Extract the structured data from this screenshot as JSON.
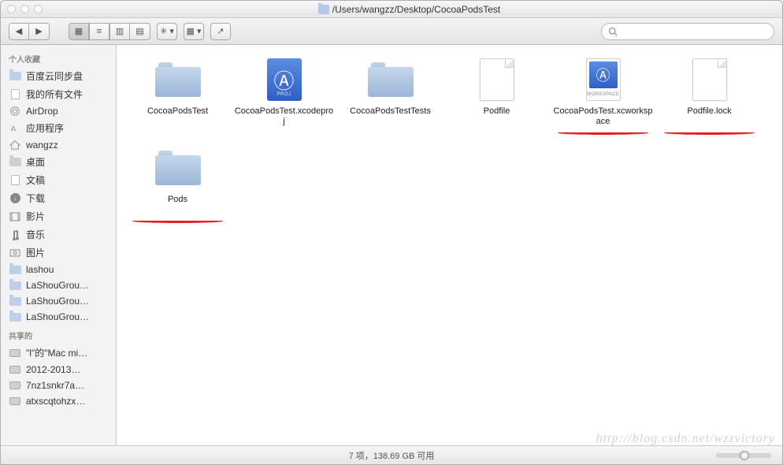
{
  "title": "/Users/wangzz/Desktop/CocoaPodsTest",
  "search": {
    "placeholder": ""
  },
  "sidebar": {
    "section_favorites": "个人收藏",
    "section_shared": "共享的",
    "favorites": [
      {
        "label": "百度云同步盘",
        "icon": "folder"
      },
      {
        "label": "我的所有文件",
        "icon": "doc"
      },
      {
        "label": "AirDrop",
        "icon": "airdrop"
      },
      {
        "label": "应用程序",
        "icon": "app"
      },
      {
        "label": "wangzz",
        "icon": "home"
      },
      {
        "label": "桌面",
        "icon": "folder-gray"
      },
      {
        "label": "文稿",
        "icon": "doc"
      },
      {
        "label": "下载",
        "icon": "download"
      },
      {
        "label": "影片",
        "icon": "movie"
      },
      {
        "label": "音乐",
        "icon": "music"
      },
      {
        "label": "图片",
        "icon": "photo"
      },
      {
        "label": "lashou",
        "icon": "folder"
      },
      {
        "label": "LaShouGrou…",
        "icon": "folder"
      },
      {
        "label": "LaShouGrou…",
        "icon": "folder"
      },
      {
        "label": "LaShouGrou…",
        "icon": "folder"
      }
    ],
    "shared": [
      {
        "label": "\"l\"的\"Mac mi…",
        "icon": "disk"
      },
      {
        "label": "2012-2013…",
        "icon": "disk"
      },
      {
        "label": "7nz1snkr7a…",
        "icon": "disk"
      },
      {
        "label": "atxscqtohzx…",
        "icon": "disk"
      }
    ]
  },
  "files": [
    {
      "name": "CocoaPodsTest",
      "type": "folder",
      "underline": false
    },
    {
      "name": "CocoaPodsTest.xcodeproj",
      "type": "xcodeproj",
      "underline": false
    },
    {
      "name": "CocoaPodsTestTests",
      "type": "folder",
      "underline": false
    },
    {
      "name": "Podfile",
      "type": "document",
      "underline": false
    },
    {
      "name": "CocoaPodsTest.xcworkspace",
      "type": "workspace",
      "underline": true
    },
    {
      "name": "Podfile.lock",
      "type": "document",
      "underline": true
    },
    {
      "name": "Pods",
      "type": "folder",
      "underline": true
    }
  ],
  "status": "7 项，138.69 GB 可用",
  "watermark": "http://blog.csdn.net/wzzvictory",
  "workspace_label": "WORKSPACE",
  "proj_label": "PROJ"
}
